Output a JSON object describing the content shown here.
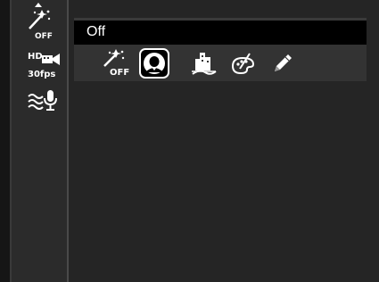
{
  "sidebar": {
    "effect": {
      "icon": "magic-wand-icon",
      "caption": "OFF"
    },
    "video_quality": {
      "icon": "hd-video-icon",
      "badge": "HD",
      "caption": "30fps"
    },
    "audio": {
      "icon": "wind-noise-mic-icon"
    }
  },
  "setting": {
    "value": "Off"
  },
  "options": [
    {
      "icon": "magic-wand-off-icon",
      "caption": "OFF",
      "selected": false
    },
    {
      "icon": "portrait-icon",
      "selected": true
    },
    {
      "icon": "city-landscape-icon",
      "selected": false
    },
    {
      "icon": "art-palette-icon",
      "selected": false
    },
    {
      "icon": "pencil-sketch-icon",
      "selected": false
    }
  ],
  "colors": {
    "background": "#1c1c1c",
    "sidebar": "#2b2b2b",
    "bar": "#000000",
    "strip": "#333333",
    "text": "#ffffff"
  }
}
